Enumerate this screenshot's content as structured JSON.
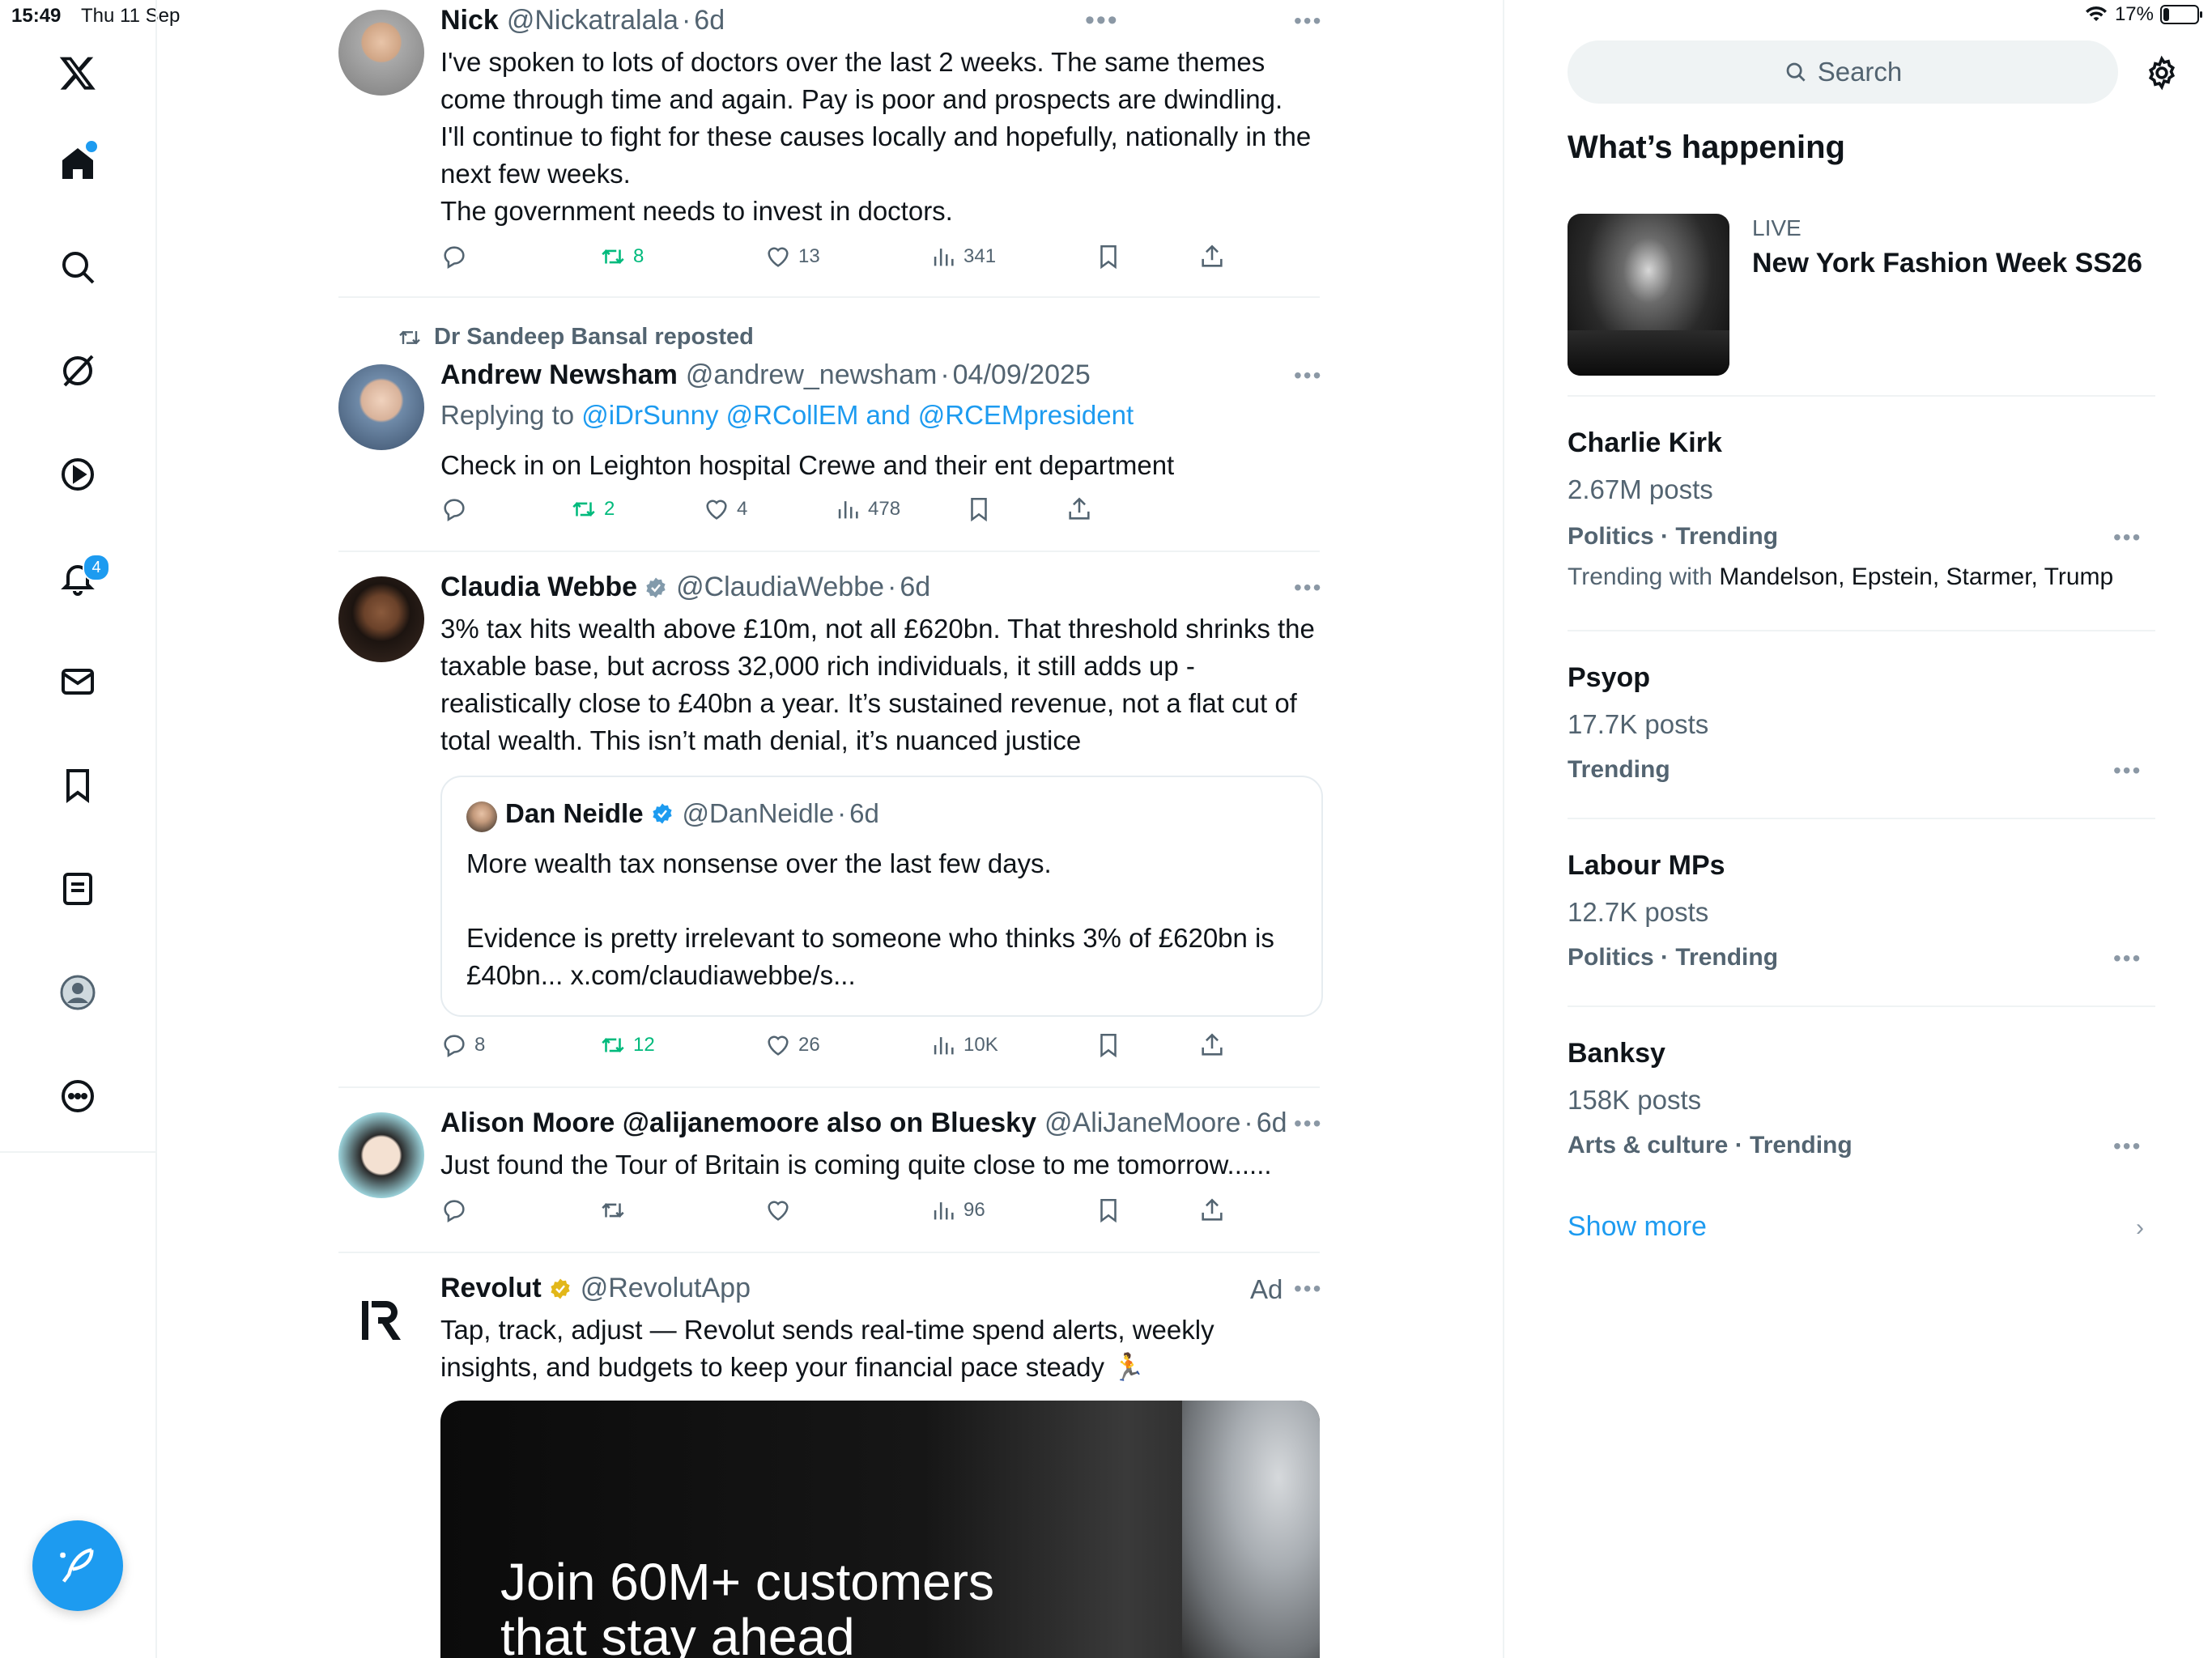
{
  "status": {
    "time": "15:49",
    "date": "Thu 11 Sep",
    "battery": "17%",
    "battery_level": 0.17
  },
  "nav": {
    "notification_count": "4",
    "items": [
      "home-icon",
      "search-icon",
      "grok-icon",
      "video-icon",
      "bell-icon",
      "mail-icon",
      "bookmark-icon",
      "list-icon",
      "profile-icon",
      "more-icon"
    ]
  },
  "posts": [
    {
      "name": "Nick",
      "handle": "@Nickatralala",
      "time": "6d",
      "text": "I've spoken to lots of doctors over the last 2 weeks. The same themes come through time and again. Pay is poor and prospects are dwindling.\nI'll continue to fight for these causes locally and hopefully, nationally in the next few weeks.\nThe government needs to invest in doctors.",
      "reposts": "8",
      "likes": "13",
      "views": "341"
    },
    {
      "repost_by": "Dr Sandeep Bansal reposted",
      "name": "Andrew Newsham",
      "handle": "@andrew_newsham",
      "time": "04/09/2025",
      "replying_prefix": "Replying to",
      "replying_to": "@iDrSunny @RCollEM and @RCEMpresident",
      "text": "Check in on Leighton hospital Crewe and their ent department",
      "reposts": "2",
      "likes": "4",
      "views": "478"
    },
    {
      "name": "Claudia Webbe",
      "handle": "@ClaudiaWebbe",
      "time": "6d",
      "text": "3% tax hits wealth above £10m, not all £620bn. That threshold shrinks the taxable base, but across 32,000 rich individuals, it still adds up - realistically close to £40bn a year. It’s sustained revenue, not a flat cut of total wealth. This isn’t math denial, it’s nuanced justice",
      "quote": {
        "name": "Dan Neidle",
        "handle": "@DanNeidle",
        "time": "6d",
        "text": "More wealth tax nonsense over the last few days.\n\nEvidence is pretty irrelevant to someone who thinks 3% of £620bn is £40bn... x.com/claudiawebbe/s..."
      },
      "replies": "8",
      "reposts": "12",
      "likes": "26",
      "views": "10K"
    },
    {
      "name": "Alison Moore @alijanemoore also on Bluesky",
      "handle": "@AliJaneMoore",
      "time": "6d",
      "text": "Just found the Tour of Britain is coming quite close to me tomorrow......",
      "views": "96"
    },
    {
      "name": "Revolut",
      "handle": "@RevolutApp",
      "ad_label": "Ad",
      "text": "Tap, track, adjust — Revolut sends real-time spend alerts, weekly insights, and budgets to keep your financial pace steady 🏃",
      "media_text": "Join 60M+ customers\nthat stay ahead"
    }
  ],
  "right": {
    "search_placeholder": "Search",
    "heading": "What’s happening",
    "featured": {
      "label": "LIVE",
      "title": "New York Fashion Week SS26"
    },
    "trends": [
      {
        "name": "Charlie Kirk",
        "posts": "2.67M posts",
        "category": "Politics · Trending",
        "with_label": "Trending with",
        "with": "Mandelson, Epstein, Starmer, Trump"
      },
      {
        "name": "Psyop",
        "posts": "17.7K posts",
        "category": "Trending"
      },
      {
        "name": "Labour MPs",
        "posts": "12.7K posts",
        "category": "Politics · Trending"
      },
      {
        "name": "Banksy",
        "posts": "158K posts",
        "category": "Arts & culture · Trending"
      }
    ],
    "show_more": "Show more"
  }
}
